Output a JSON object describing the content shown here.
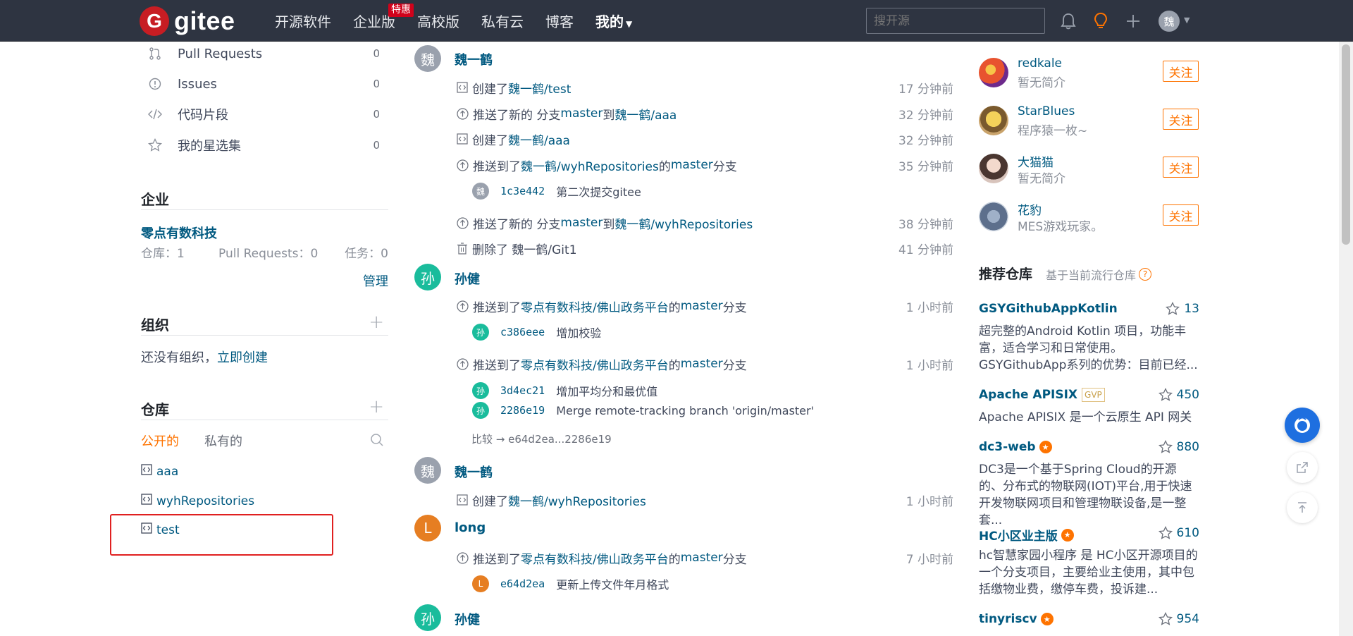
{
  "header": {
    "logo_letter": "G",
    "logo_text": "gitee",
    "nav": [
      "开源软件",
      "企业版",
      "高校版",
      "私有云",
      "博客"
    ],
    "mine": "我的",
    "promo_badge": "特惠",
    "search_placeholder": "搜开源",
    "avatar_letter": "魏"
  },
  "left": {
    "nav": [
      {
        "label": "Pull Requests",
        "count": "0",
        "icon": "pull-request-icon"
      },
      {
        "label": "Issues",
        "count": "0",
        "icon": "issue-icon"
      },
      {
        "label": "代码片段",
        "count": "0",
        "icon": "code-icon"
      },
      {
        "label": "我的星选集",
        "count": "0",
        "icon": "star-icon"
      }
    ],
    "enterprise": {
      "title": "企业",
      "name": "零点有数科技",
      "repos": "仓库：1",
      "prs": "Pull Requests：0",
      "tasks": "任务：0",
      "manage": "管理"
    },
    "org": {
      "title": "组织",
      "text": "还没有组织，",
      "create": "立即创建"
    },
    "repos": {
      "title": "仓库",
      "tab_public": "公开的",
      "tab_private": "私有的",
      "items": [
        "aaa",
        "wyhRepositories",
        "test"
      ]
    }
  },
  "feed": {
    "groups": [
      {
        "user": "魏一鹤",
        "avatar": "魏",
        "color": "#9aa1ad"
      },
      {
        "user": "孙健",
        "avatar": "孙",
        "color": "#1abc9c"
      },
      {
        "user": "魏一鹤",
        "avatar": "魏",
        "color": "#9aa1ad"
      },
      {
        "user": "long",
        "avatar": "L",
        "color": "#e67e22"
      },
      {
        "user": "孙健",
        "avatar": "孙",
        "color": "#1abc9c"
      }
    ],
    "events": [
      {
        "icon": "repo-icon",
        "a": "创建了 ",
        "link1": "魏一鹤/test",
        "b": "",
        "link2": "",
        "c": "",
        "time": "17 分钟前"
      },
      {
        "icon": "push-icon",
        "a": "推送了新的 分支 ",
        "link1": "master",
        "b": " 到 ",
        "link2": "魏一鹤/aaa",
        "c": "",
        "time": "32 分钟前"
      },
      {
        "icon": "repo-icon",
        "a": "创建了 ",
        "link1": "魏一鹤/aaa",
        "b": "",
        "link2": "",
        "c": "",
        "time": "32 分钟前"
      },
      {
        "icon": "push-icon",
        "a": "推送到了 ",
        "link1": "魏一鹤/wyhRepositories",
        "b": " 的 ",
        "link2": "master",
        "c": " 分支",
        "time": "35 分钟前"
      },
      {
        "icon": "push-icon",
        "a": "推送了新的 分支 ",
        "link1": "master",
        "b": " 到 ",
        "link2": "魏一鹤/wyhRepositories",
        "c": "",
        "time": "38 分钟前"
      },
      {
        "icon": "trash-icon",
        "a": "删除了 魏一鹤/Git1",
        "link1": "",
        "b": "",
        "link2": "",
        "c": "",
        "time": "41 分钟前"
      },
      {
        "icon": "push-icon",
        "a": "推送到了 ",
        "link1": "零点有数科技/佛山政务平台",
        "b": " 的 ",
        "link2": "master",
        "c": " 分支",
        "time": "1 小时前"
      },
      {
        "icon": "push-icon",
        "a": "推送到了 ",
        "link1": "零点有数科技/佛山政务平台",
        "b": " 的 ",
        "link2": "master",
        "c": " 分支",
        "time": "1 小时前"
      },
      {
        "icon": "repo-icon",
        "a": "创建了 ",
        "link1": "魏一鹤/wyhRepositories",
        "b": "",
        "link2": "",
        "c": "",
        "time": "1 小时前"
      },
      {
        "icon": "push-icon",
        "a": "推送到了 ",
        "link1": "零点有数科技/佛山政务平台",
        "b": " 的 ",
        "link2": "master",
        "c": " 分支",
        "time": "7 小时前"
      }
    ],
    "commits": [
      {
        "avatar": "魏",
        "color": "#9aa1ad",
        "sha": "1c3e442",
        "msg": "第二次提交gitee"
      },
      {
        "avatar": "孙",
        "color": "#1abc9c",
        "sha": "c386eee",
        "msg": "增加校验"
      },
      {
        "avatar": "孙",
        "color": "#1abc9c",
        "sha": "3d4ec21",
        "msg": "增加平均分和最优值"
      },
      {
        "avatar": "孙",
        "color": "#1abc9c",
        "sha": "2286e19",
        "msg": "Merge remote-tracking branch 'origin/master'"
      },
      {
        "avatar": "L",
        "color": "#e67e22",
        "sha": "e64d2ea",
        "msg": "更新上传文件年月格式"
      }
    ],
    "compare": "比较 → e64d2ea...2286e19"
  },
  "right": {
    "users": [
      {
        "name": "redkale",
        "bio": "暂无简介"
      },
      {
        "name": "StarBlues",
        "bio": "程序猿一枚~"
      },
      {
        "name": "大猫猫",
        "bio": "暂无简介"
      },
      {
        "name": "花豹",
        "bio": "MES游戏玩家。"
      }
    ],
    "follow_label": "关注",
    "rec_title": "推荐仓库",
    "rec_sub": "基于当前流行仓库",
    "repos": [
      {
        "name": "GSYGithubAppKotlin",
        "stars": "13",
        "desc": "超完整的Android Kotlin 项目，功能丰富，适合学习和日常使用。GSYGithubApp系列的优势：目前已经..."
      },
      {
        "name": "Apache APISIX",
        "stars": "450",
        "desc": "Apache APISIX 是一个云原生 API 网关",
        "badge": "GVP"
      },
      {
        "name": "dc3-web",
        "stars": "880",
        "desc": "DC3是一个基于Spring Cloud的开源的、分布式的物联网(IOT)平台,用于快速开发物联网项目和管理物联设备,是一整套..."
      },
      {
        "name": "HC小区业主版",
        "stars": "610",
        "desc": "hc智慧家园小程序 是 HC小区开源项目的一个分支项目，主要给业主使用，其中包括缴物业费，缴停车费，投诉建..."
      },
      {
        "name": "tinyriscv",
        "stars": "954",
        "desc": ""
      }
    ]
  }
}
